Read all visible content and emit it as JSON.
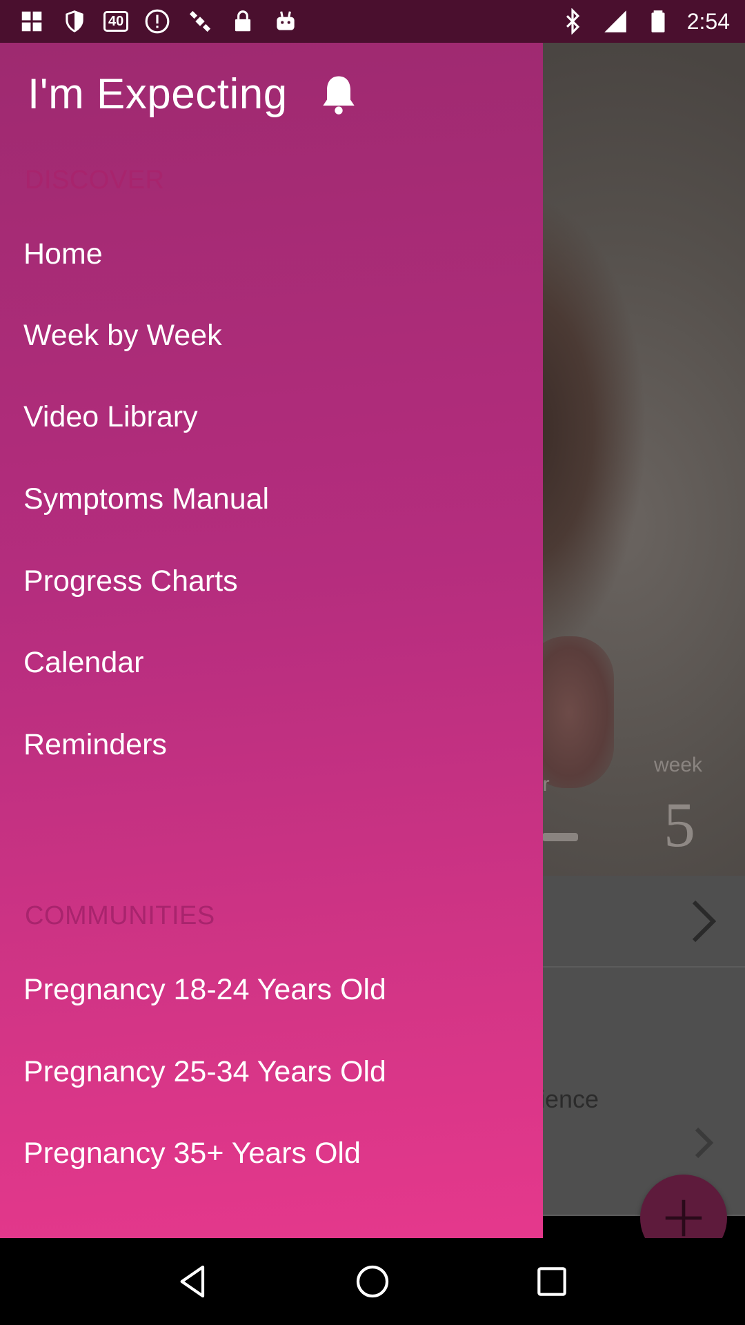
{
  "status_bar": {
    "time": "2:54",
    "badge": "40",
    "icons": [
      "grid-icon",
      "shield-icon",
      "badge-40-icon",
      "info-icon",
      "satellite-icon",
      "lock-icon",
      "android-icon",
      "bluetooth-icon",
      "signal-icon",
      "battery-icon"
    ]
  },
  "drawer": {
    "title": "I'm Expecting",
    "discover_label": "DISCOVER",
    "discover_items": [
      {
        "label": "Home"
      },
      {
        "label": "Week by Week"
      },
      {
        "label": "Video Library"
      },
      {
        "label": "Symptoms Manual"
      },
      {
        "label": "Progress Charts"
      },
      {
        "label": "Calendar"
      },
      {
        "label": "Reminders"
      }
    ],
    "communities_label": "COMMUNITIES",
    "community_items": [
      {
        "label": "Pregnancy 18-24 Years Old"
      },
      {
        "label": "Pregnancy 25-34 Years Old"
      },
      {
        "label": "Pregnancy 35+ Years Old"
      }
    ]
  },
  "background": {
    "week_label": "week",
    "week_number": "5",
    "partial_label": "er",
    "row_text": "rience"
  },
  "colors": {
    "drawer_top": "#9e2a70",
    "drawer_bottom": "#e5388c",
    "section_label": "#a8246d",
    "fab": "#5e1b3c",
    "status_bar": "#4a0f2e"
  }
}
